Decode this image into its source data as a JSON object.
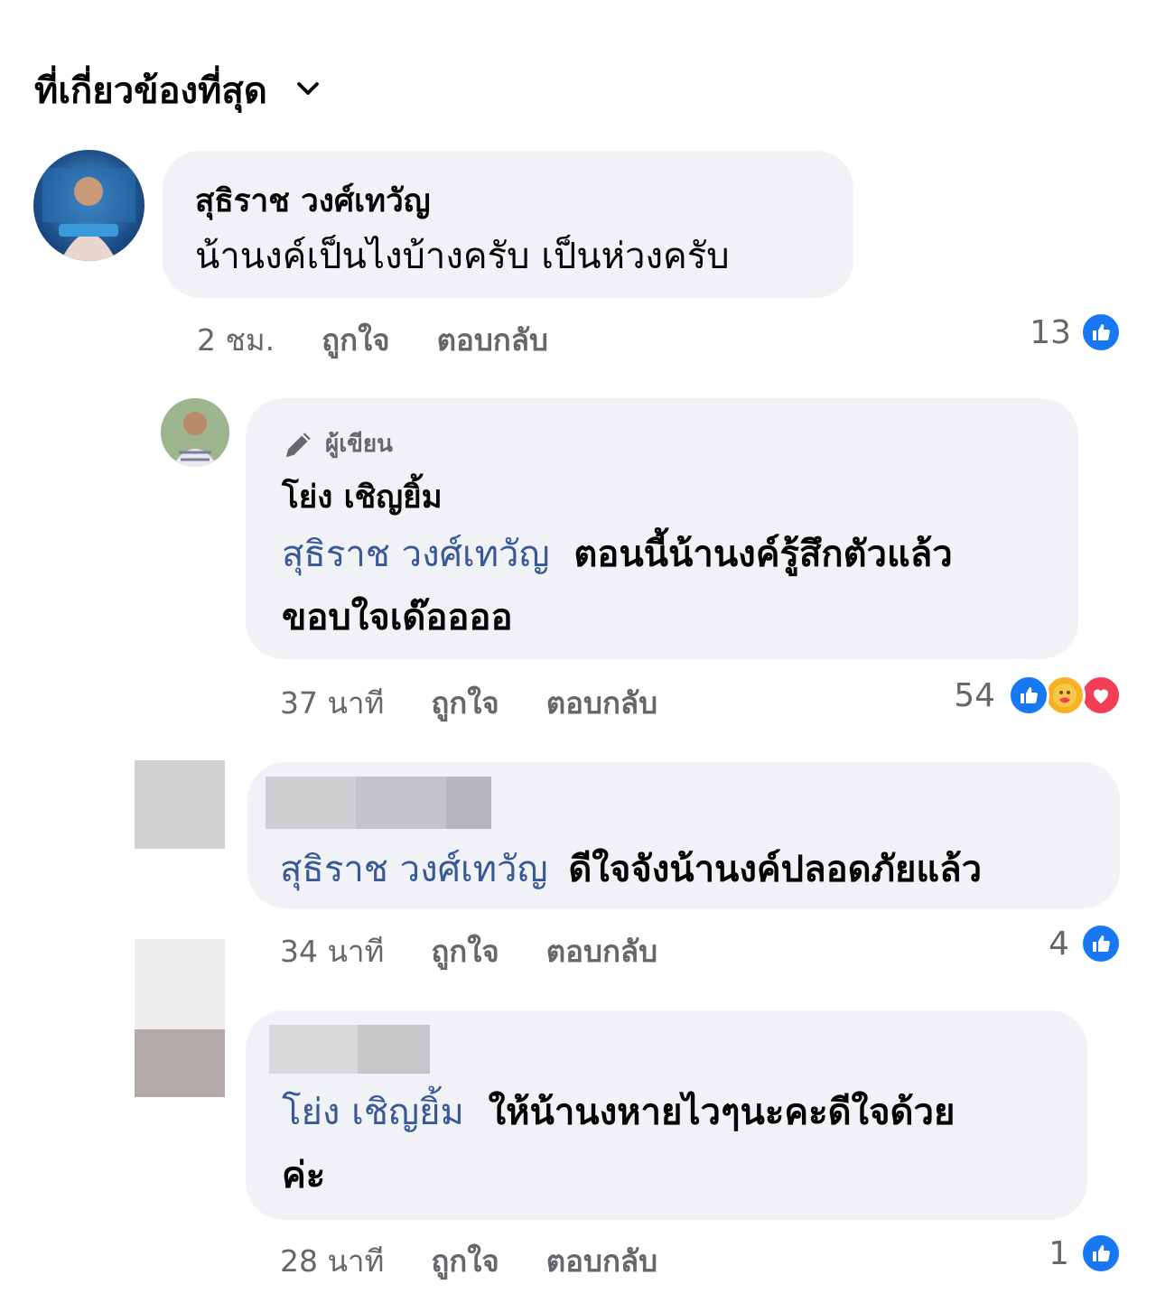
{
  "sort": {
    "label": "ที่เกี่ยวข้องที่สุด"
  },
  "comments": [
    {
      "author": "สุธิราช วงศ์เทวัญ",
      "text": "น้านงค์เป็นไงบ้างครับ เป็นห่วงครับ",
      "time": "2 ชม.",
      "like": "ถูกใจ",
      "reply": "ตอบกลับ",
      "reaction_count": "13",
      "reactions": [
        "like-icon"
      ]
    },
    {
      "badge": "ผู้เขียน",
      "author": "โย่ง เชิญยิ้ม",
      "mention": "สุธิราช วงศ์เทวัญ",
      "text_line1": "ตอนนี้น้านงค์รู้สึกตัวแล้ว",
      "text_line2": "ขอบใจเด๊ออออ",
      "time": "37 นาที",
      "like": "ถูกใจ",
      "reply": "ตอบกลับ",
      "reaction_count": "54",
      "reactions": [
        "like-icon",
        "care-icon",
        "heart-icon"
      ]
    },
    {
      "mention": "สุธิราช วงศ์เทวัญ",
      "text": "ดีใจจังน้านงค์ปลอดภัยแล้ว",
      "time": "34 นาที",
      "like": "ถูกใจ",
      "reply": "ตอบกลับ",
      "reaction_count": "4",
      "reactions": [
        "like-icon"
      ]
    },
    {
      "mention": "โย่ง เชิญยิ้ม",
      "text_line1": "ให้น้านงหายไวๆนะคะดีใจด้วย",
      "text_line2": "ค่ะ",
      "time": "28 นาที",
      "like": "ถูกใจ",
      "reply": "ตอบกลับ",
      "reaction_count": "1",
      "reactions": [
        "like-icon"
      ]
    }
  ],
  "colors": {
    "bubble": "#f0f2f5",
    "mention": "#385898",
    "like": "#1877f2",
    "heart": "#f33e58",
    "meta": "#65676b"
  }
}
